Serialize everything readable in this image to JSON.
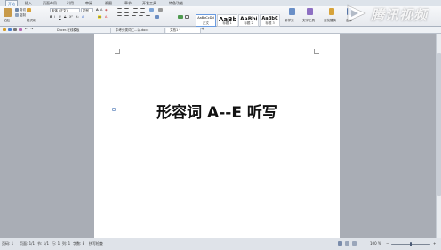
{
  "menu": {
    "tabs": [
      "开始",
      "插入",
      "页面布局",
      "引用",
      "审阅",
      "视图",
      "章节",
      "开发工具",
      "特色功能"
    ],
    "active_index": 0
  },
  "ribbon": {
    "paste_label": "粘贴",
    "cut_label": "剪切",
    "copy_label": "复制",
    "format_painter_label": "格式刷",
    "font_name": "宋体 (正文)",
    "font_size": "初号",
    "styles": [
      {
        "sample": "AaBbCcDd",
        "label": "正文"
      },
      {
        "sample": "AaBb",
        "label": "标题 1"
      },
      {
        "sample": "AaBb(",
        "label": "标题 2"
      },
      {
        "sample": "AaBbC",
        "label": "标题 3"
      }
    ],
    "new_style_label": "新样式",
    "text_tools_label": "文字工具",
    "find_replace_label": "查找替换",
    "select_label": "选择"
  },
  "doc_tabs": [
    {
      "label": "Docer-在线模板",
      "active": false
    },
    {
      "label": "中考分类词汇...以.docx",
      "active": false
    },
    {
      "label": "文档1 *",
      "active": true
    }
  ],
  "document": {
    "title": "形容词 A--E 听写"
  },
  "status": {
    "page": "页码: 1",
    "pages": "页面: 1/1",
    "section": "节: 1/1",
    "row": "行: 1",
    "column": "列: 1",
    "chars": "字数: 8",
    "spell": "拼写检查",
    "zoom": "100 %"
  },
  "watermark": {
    "text": "腾讯视频"
  },
  "colors": {
    "accent": "#1c5ea7",
    "workspace": "#a9adb5",
    "page": "#ffffff"
  }
}
